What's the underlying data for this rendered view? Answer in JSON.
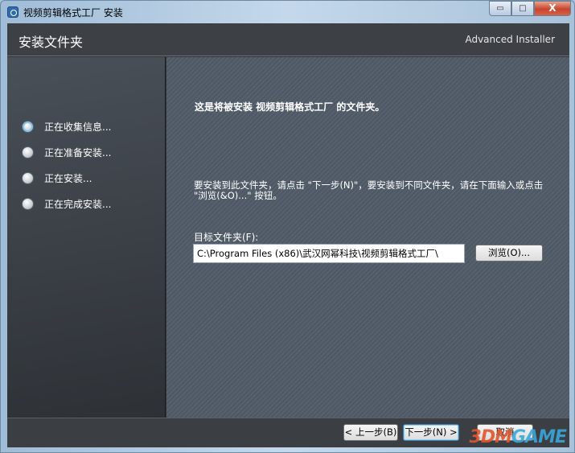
{
  "window": {
    "title": "视频剪辑格式工厂 安装",
    "minimize": "▭",
    "maximize": "□",
    "close": "X"
  },
  "header": {
    "title": "安装文件夹",
    "brand": "Advanced Installer"
  },
  "steps": [
    {
      "label": "正在收集信息...",
      "active": true
    },
    {
      "label": "正在准备安装...",
      "active": false
    },
    {
      "label": "正在安装...",
      "active": false
    },
    {
      "label": "正在完成安装...",
      "active": false
    }
  ],
  "main": {
    "heading": "这是将被安装 视频剪辑格式工厂 的文件夹。",
    "instructions": "要安装到此文件夹，请点击 \"下一步(N)\"，要安装到不同文件夹，请在下面输入或点击 \"浏览(&O)...\" 按钮。",
    "folder_label": "目标文件夹(F):",
    "folder_value": "C:\\Program Files (x86)\\武汉网幂科技\\视频剪辑格式工厂\\",
    "browse_label": "浏览(O)..."
  },
  "footer": {
    "back_label": "< 上一步(B)",
    "next_label": "下一步(N) >",
    "cancel_label": "取消"
  },
  "watermark": {
    "part1": "3DM",
    "part2": "GAME"
  }
}
